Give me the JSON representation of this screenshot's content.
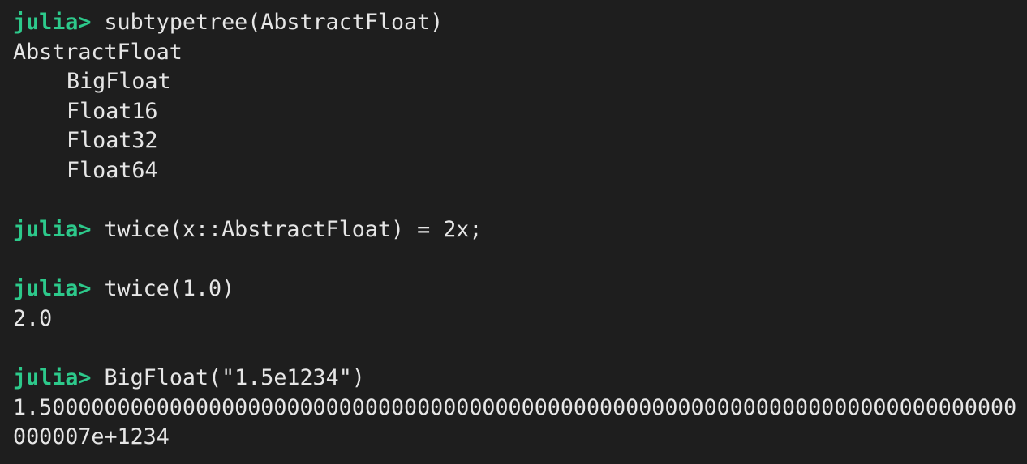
{
  "terminal": {
    "prompt": "julia>",
    "entries": [
      {
        "input": "subtypetree(AbstractFloat)",
        "output_root": "AbstractFloat",
        "output_children": [
          "BigFloat",
          "Float16",
          "Float32",
          "Float64"
        ]
      },
      {
        "input": "twice(x::AbstractFloat) = 2x;"
      },
      {
        "input": "twice(1.0)",
        "output": "2.0"
      },
      {
        "input": "BigFloat(\"1.5e1234\")",
        "output_line1": "1.500000000000000000000000000000000000000000000000000000000000000000000000000000",
        "output_line2": "000007e+1234"
      }
    ]
  },
  "colors": {
    "background": "#1e1e1e",
    "prompt": "#2dc98b",
    "text": "#e6e6e6"
  }
}
